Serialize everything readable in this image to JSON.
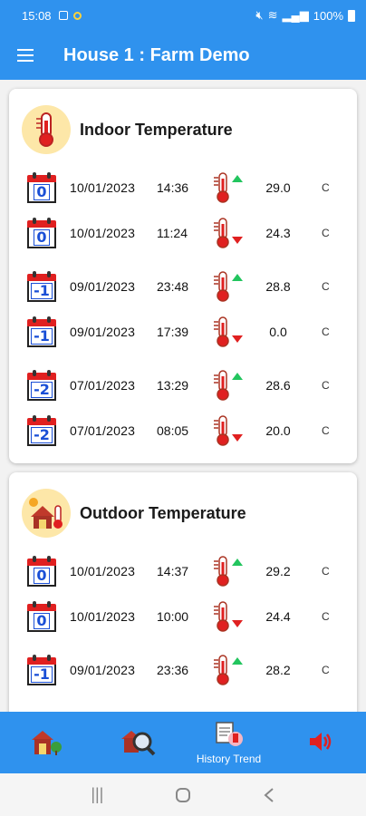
{
  "status_bar": {
    "time": "15:08",
    "battery": "100%"
  },
  "app_bar": {
    "title": "House 1 : Farm Demo"
  },
  "indoor": {
    "title": "Indoor Temperature",
    "rows": [
      {
        "day_offset": "0",
        "date": "10/01/2023",
        "time": "14:36",
        "trend": "up",
        "value": "29.0",
        "unit": "C"
      },
      {
        "day_offset": "0",
        "date": "10/01/2023",
        "time": "11:24",
        "trend": "down",
        "value": "24.3",
        "unit": "C"
      },
      {
        "day_offset": "-1",
        "date": "09/01/2023",
        "time": "23:48",
        "trend": "up",
        "value": "28.8",
        "unit": "C"
      },
      {
        "day_offset": "-1",
        "date": "09/01/2023",
        "time": "17:39",
        "trend": "down",
        "value": "0.0",
        "unit": "C"
      },
      {
        "day_offset": "-2",
        "date": "07/01/2023",
        "time": "13:29",
        "trend": "up",
        "value": "28.6",
        "unit": "C"
      },
      {
        "day_offset": "-2",
        "date": "07/01/2023",
        "time": "08:05",
        "trend": "down",
        "value": "20.0",
        "unit": "C"
      }
    ]
  },
  "outdoor": {
    "title": "Outdoor Temperature",
    "rows": [
      {
        "day_offset": "0",
        "date": "10/01/2023",
        "time": "14:37",
        "trend": "up",
        "value": "29.2",
        "unit": "C"
      },
      {
        "day_offset": "0",
        "date": "10/01/2023",
        "time": "10:00",
        "trend": "down",
        "value": "24.4",
        "unit": "C"
      },
      {
        "day_offset": "-1",
        "date": "09/01/2023",
        "time": "23:36",
        "trend": "up",
        "value": "28.2",
        "unit": "C"
      }
    ]
  },
  "bottom_nav": {
    "items": [
      {
        "icon": "farm-icon",
        "label": ""
      },
      {
        "icon": "farm-search-icon",
        "label": ""
      },
      {
        "icon": "history-trend-icon",
        "label": "History Trend"
      },
      {
        "icon": "speaker-icon",
        "label": ""
      }
    ]
  },
  "colors": {
    "primary": "#2f92ee",
    "trend_up": "#22c55e",
    "trend_down": "#e02020",
    "calendar_number": "#1a4fd6"
  }
}
